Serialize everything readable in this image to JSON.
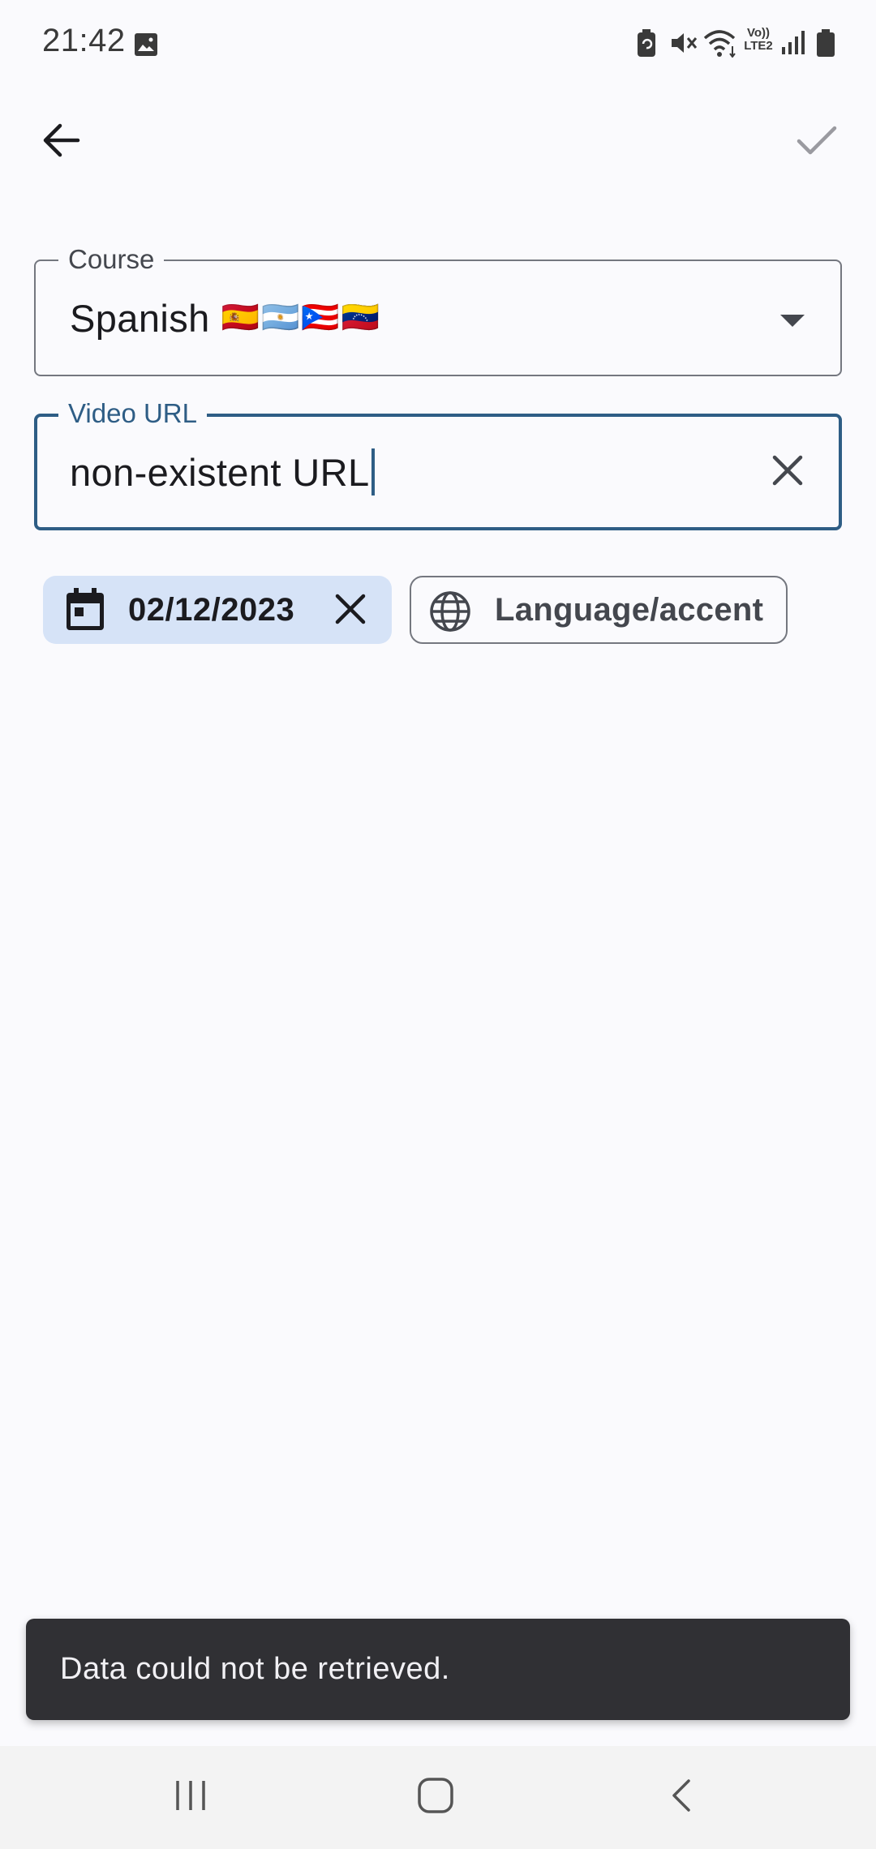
{
  "status_bar": {
    "time": "21:42",
    "network_label": "Vo)) LTE2",
    "icons": [
      "image-icon",
      "battery-saver-icon",
      "mute-icon",
      "wifi-icon",
      "volte-icon",
      "signal-icon",
      "battery-icon"
    ]
  },
  "toolbar": {
    "back_icon": "arrow-back-icon",
    "confirm_icon": "check-icon"
  },
  "form": {
    "course": {
      "label": "Course",
      "value": "Spanish",
      "flags": "🇪🇸🇦🇷🇵🇷🇻🇪"
    },
    "video_url": {
      "label": "Video URL",
      "value": "non-existent URL"
    }
  },
  "chips": {
    "date": {
      "label": "02/12/2023",
      "icon": "calendar-icon"
    },
    "language": {
      "label": "Language/accent",
      "icon": "globe-icon"
    }
  },
  "snackbar": {
    "message": "Data could not be retrieved."
  },
  "nav_bar": {
    "buttons": [
      "recent-apps-icon",
      "home-icon",
      "back-icon"
    ]
  },
  "colors": {
    "background": "#fafafd",
    "accent": "#2e5d85",
    "chip_selected": "#d6e3f7",
    "snackbar": "#303034"
  }
}
